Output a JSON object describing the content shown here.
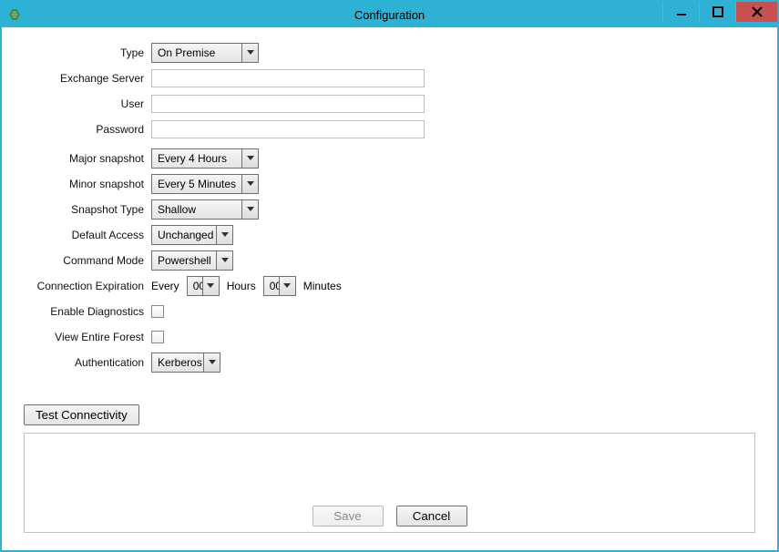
{
  "window": {
    "title": "Configuration"
  },
  "labels": {
    "type": "Type",
    "exchange_server": "Exchange Server",
    "user": "User",
    "password": "Password",
    "major_snapshot": "Major snapshot",
    "minor_snapshot": "Minor snapshot",
    "snapshot_type": "Snapshot Type",
    "default_access": "Default Access",
    "command_mode": "Command Mode",
    "connection_expiration": "Connection Expiration",
    "enable_diagnostics": "Enable Diagnostics",
    "view_entire_forest": "View Entire Forest",
    "authentication": "Authentication"
  },
  "values": {
    "type": "On Premise",
    "exchange_server": "",
    "user": "",
    "password": "",
    "major_snapshot": "Every 4 Hours",
    "minor_snapshot": "Every 5 Minutes",
    "snapshot_type": "Shallow",
    "default_access": "Unchanged",
    "command_mode": "Powershell",
    "connection_hours": "00",
    "connection_minutes": "00",
    "authentication": "Kerberos",
    "enable_diagnostics": false,
    "view_entire_forest": false
  },
  "connection_row": {
    "every": "Every",
    "hours": "Hours",
    "minutes": "Minutes"
  },
  "buttons": {
    "test_connectivity": "Test Connectivity",
    "save": "Save",
    "cancel": "Cancel"
  }
}
